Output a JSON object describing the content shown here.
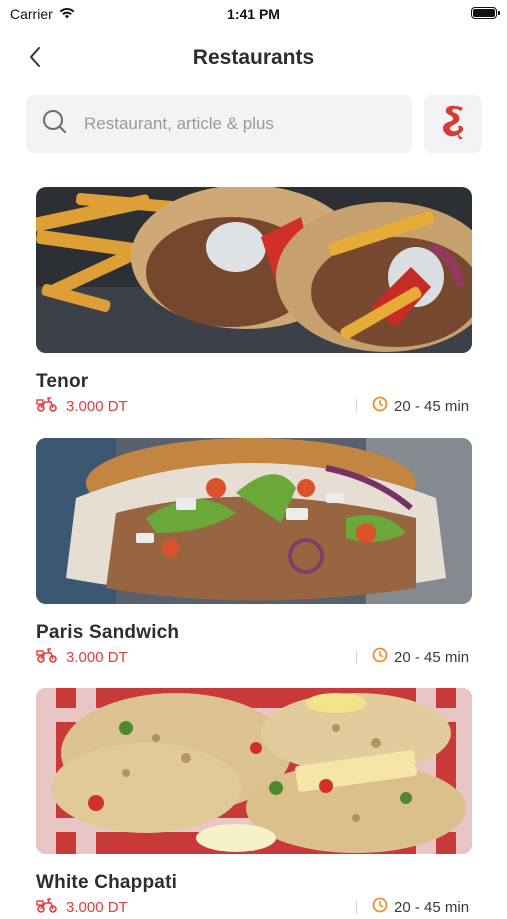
{
  "status_bar": {
    "carrier": "Carrier",
    "time": "1:41 PM"
  },
  "header": {
    "title": "Restaurants"
  },
  "search": {
    "placeholder": "Restaurant, article & plus",
    "value": ""
  },
  "colors": {
    "accent": "#e63b3b",
    "eta_icon": "#f0902a",
    "search_bg": "#f3f3f5"
  },
  "icons": {
    "back": "chevron-left-icon",
    "search": "search-icon",
    "filter": "brand-logo-icon",
    "delivery": "scooter-icon",
    "eta": "clock-icon"
  },
  "restaurants": [
    {
      "name": "Tenor",
      "delivery_fee": "3.000 DT",
      "eta": "20 - 45 min",
      "image": "gyro wraps with fries"
    },
    {
      "name": "Paris Sandwich",
      "delivery_fee": "3.000 DT",
      "eta": "20 - 45 min",
      "image": "kebab sandwich"
    },
    {
      "name": "White Chappati",
      "delivery_fee": "3.000 DT",
      "eta": "20 - 45 min",
      "image": "stuffed flatbreads"
    }
  ]
}
